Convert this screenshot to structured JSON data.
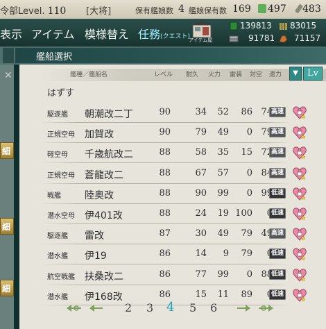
{
  "topbar": {
    "hq_label": "令部Level.",
    "hq_level": "110",
    "rank": "[大将]",
    "ships_label": "保有艦娘数",
    "ships_count": "4",
    "equip_label": "艦娘保有数",
    "equip_count": "169",
    "bucket": "497",
    "devmat": "483"
  },
  "menu": {
    "items": [
      "表示",
      "アイテム",
      "模様替え",
      "任務"
    ],
    "quest_small": "(クエスト)",
    "item_shop_label": "アイテム屋"
  },
  "resources": {
    "fuel": "139813",
    "ammo": "83015",
    "steel": "91781",
    "bauxite": "71157"
  },
  "panel": {
    "title": "艦船選択",
    "headers": {
      "type_name": "艦種／艦船名",
      "level": "レベル",
      "hp": "耐久",
      "firepower": "火力",
      "torpedo": "雷装",
      "aa": "対空",
      "speed": "速力"
    },
    "sort_label": "Lv",
    "remove_label": "はずす"
  },
  "ships": [
    {
      "type": "駆逐艦",
      "name": "朝潮改二丁",
      "level": "90",
      "hp": "34",
      "fp": "52",
      "tp": "86",
      "aa": "74",
      "speed": "高速"
    },
    {
      "type": "正規空母",
      "name": "加賀改",
      "level": "90",
      "hp": "79",
      "fp": "49",
      "tp": "0",
      "aa": "79",
      "speed": "高速"
    },
    {
      "type": "軽空母",
      "name": "千歳航改二",
      "level": "88",
      "hp": "58",
      "fp": "35",
      "tp": "15",
      "aa": "72",
      "speed": "高速"
    },
    {
      "type": "正規空母",
      "name": "蒼龍改二",
      "level": "88",
      "hp": "67",
      "fp": "57",
      "tp": "0",
      "aa": "84",
      "speed": "高速"
    },
    {
      "type": "戦艦",
      "name": "陸奥改",
      "level": "88",
      "hp": "90",
      "fp": "99",
      "tp": "0",
      "aa": "99",
      "speed": "低速"
    },
    {
      "type": "潜水空母",
      "name": "伊401改",
      "level": "88",
      "hp": "24",
      "fp": "19",
      "tp": "100",
      "aa": "0",
      "speed": "低速"
    },
    {
      "type": "駆逐艦",
      "name": "雷改",
      "level": "87",
      "hp": "30",
      "fp": "49",
      "tp": "79",
      "aa": "49",
      "speed": "高速"
    },
    {
      "type": "潜水艦",
      "name": "伊19",
      "level": "86",
      "hp": "14",
      "fp": "9",
      "tp": "79",
      "aa": "0",
      "speed": "低速"
    },
    {
      "type": "航空戦艦",
      "name": "扶桑改二",
      "level": "86",
      "hp": "77",
      "fp": "99",
      "tp": "0",
      "aa": "88",
      "speed": "低速"
    },
    {
      "type": "潜水艦",
      "name": "伊168改",
      "level": "86",
      "hp": "15",
      "fp": "11",
      "tp": "89",
      "aa": "0",
      "speed": "低速"
    }
  ],
  "pagination": {
    "pages": [
      "2",
      "3",
      "4",
      "5",
      "6"
    ],
    "current": "4"
  },
  "side_label": "細",
  "colors": {
    "accent": "#1fa3b7",
    "lock_pink": "#e98aa6"
  }
}
